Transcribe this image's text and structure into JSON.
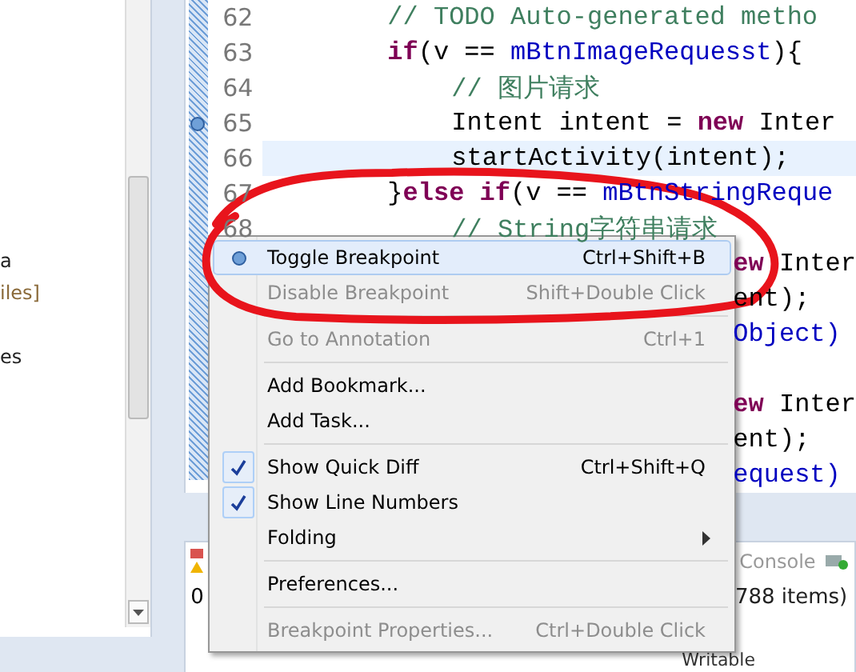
{
  "explorer": {
    "items": [
      {
        "text": "a",
        "kind": "plain"
      },
      {
        "text": "iles]",
        "kind": "decoration"
      },
      {
        "text": "es",
        "kind": "plain"
      }
    ]
  },
  "editor": {
    "lines": [
      {
        "number": "62",
        "kind": "outer",
        "current": false,
        "breakpoint": false,
        "segments": [
          {
            "kind": "comment",
            "text": "// TODO Auto-generated metho"
          }
        ]
      },
      {
        "number": "63",
        "kind": "outer",
        "current": false,
        "breakpoint": false,
        "segments": [
          {
            "kind": "keyword",
            "text": "if"
          },
          {
            "kind": "plain",
            "text": "(v =="
          },
          {
            "kind": "field",
            "text": "mBtnImageRequesst"
          },
          {
            "kind": "plain",
            "text": "){"
          }
        ]
      },
      {
        "number": "64",
        "kind": "inner",
        "current": false,
        "breakpoint": false,
        "segments": [
          {
            "kind": "comment",
            "text": "// 图片请求"
          }
        ]
      },
      {
        "number": "65",
        "kind": "inner",
        "current": false,
        "breakpoint": true,
        "segments": [
          {
            "kind": "plain",
            "text": "Intent intent ="
          },
          {
            "kind": "keyword",
            "text": "new"
          },
          {
            "kind": "plain",
            "text": "Inter"
          }
        ]
      },
      {
        "number": "66",
        "kind": "inner",
        "current": true,
        "breakpoint": false,
        "segments": [
          {
            "kind": "plain",
            "text": "startActivity(intent);"
          }
        ]
      },
      {
        "number": "67",
        "kind": "outer",
        "current": false,
        "breakpoint": false,
        "segments": [
          {
            "kind": "plain",
            "text": "}"
          },
          {
            "kind": "keyword",
            "text": "else if"
          },
          {
            "kind": "plain",
            "text": "(v =="
          },
          {
            "kind": "field",
            "text": "mBtnStringReque"
          }
        ]
      },
      {
        "number": "68",
        "kind": "inner",
        "current": false,
        "breakpoint": false,
        "segments": [
          {
            "kind": "comment",
            "text": "// String字符串请求"
          }
        ]
      }
    ],
    "tails": [
      {
        "kind": "code",
        "segments": [
          {
            "kind": "keyword",
            "text": "ew"
          },
          {
            "kind": "plain",
            "text": "Inter"
          }
        ]
      },
      {
        "kind": "code",
        "segments": [
          {
            "kind": "plain",
            "text": "ent);"
          }
        ]
      },
      {
        "kind": "code",
        "segments": [
          {
            "kind": "field",
            "text": "Object)"
          }
        ]
      },
      {
        "kind": "blank"
      },
      {
        "kind": "code",
        "segments": [
          {
            "kind": "keyword",
            "text": "ew"
          },
          {
            "kind": "plain",
            "text": "Inter"
          }
        ]
      },
      {
        "kind": "code",
        "segments": [
          {
            "kind": "plain",
            "text": "ent);"
          }
        ]
      },
      {
        "kind": "code",
        "segments": [
          {
            "kind": "field",
            "text": "equest)"
          }
        ]
      }
    ]
  },
  "bottom_panel": {
    "tab": "Console",
    "count": "0",
    "items": "788 items)",
    "column": "Writable"
  },
  "context_menu": {
    "groups": [
      [
        {
          "label": "Toggle Breakpoint",
          "shortcut": "Ctrl+Shift+B",
          "kind": "breakpoint",
          "selected": true,
          "disabled": false,
          "checked": false,
          "submenu": false
        },
        {
          "label": "Disable Breakpoint",
          "shortcut": "Shift+Double Click",
          "selected": false,
          "disabled": true,
          "checked": false,
          "submenu": false
        }
      ],
      [
        {
          "label": "Go to Annotation",
          "shortcut": "Ctrl+1",
          "selected": false,
          "disabled": true,
          "checked": false,
          "submenu": false
        }
      ],
      [
        {
          "label": "Add Bookmark...",
          "selected": false,
          "disabled": false,
          "checked": false,
          "submenu": false
        },
        {
          "label": "Add Task...",
          "selected": false,
          "disabled": false,
          "checked": false,
          "submenu": false
        }
      ],
      [
        {
          "label": "Show Quick Diff",
          "shortcut": "Ctrl+Shift+Q",
          "selected": false,
          "disabled": false,
          "checked": true,
          "submenu": false
        },
        {
          "label": "Show Line Numbers",
          "selected": false,
          "disabled": false,
          "checked": true,
          "submenu": false
        },
        {
          "label": "Folding",
          "selected": false,
          "disabled": false,
          "checked": false,
          "submenu": true
        }
      ],
      [
        {
          "label": "Preferences...",
          "selected": false,
          "disabled": false,
          "checked": false,
          "submenu": false
        }
      ],
      [
        {
          "label": "Breakpoint Properties...",
          "shortcut": "Ctrl+Double Click",
          "selected": false,
          "disabled": true,
          "checked": false,
          "submenu": false
        }
      ]
    ]
  }
}
